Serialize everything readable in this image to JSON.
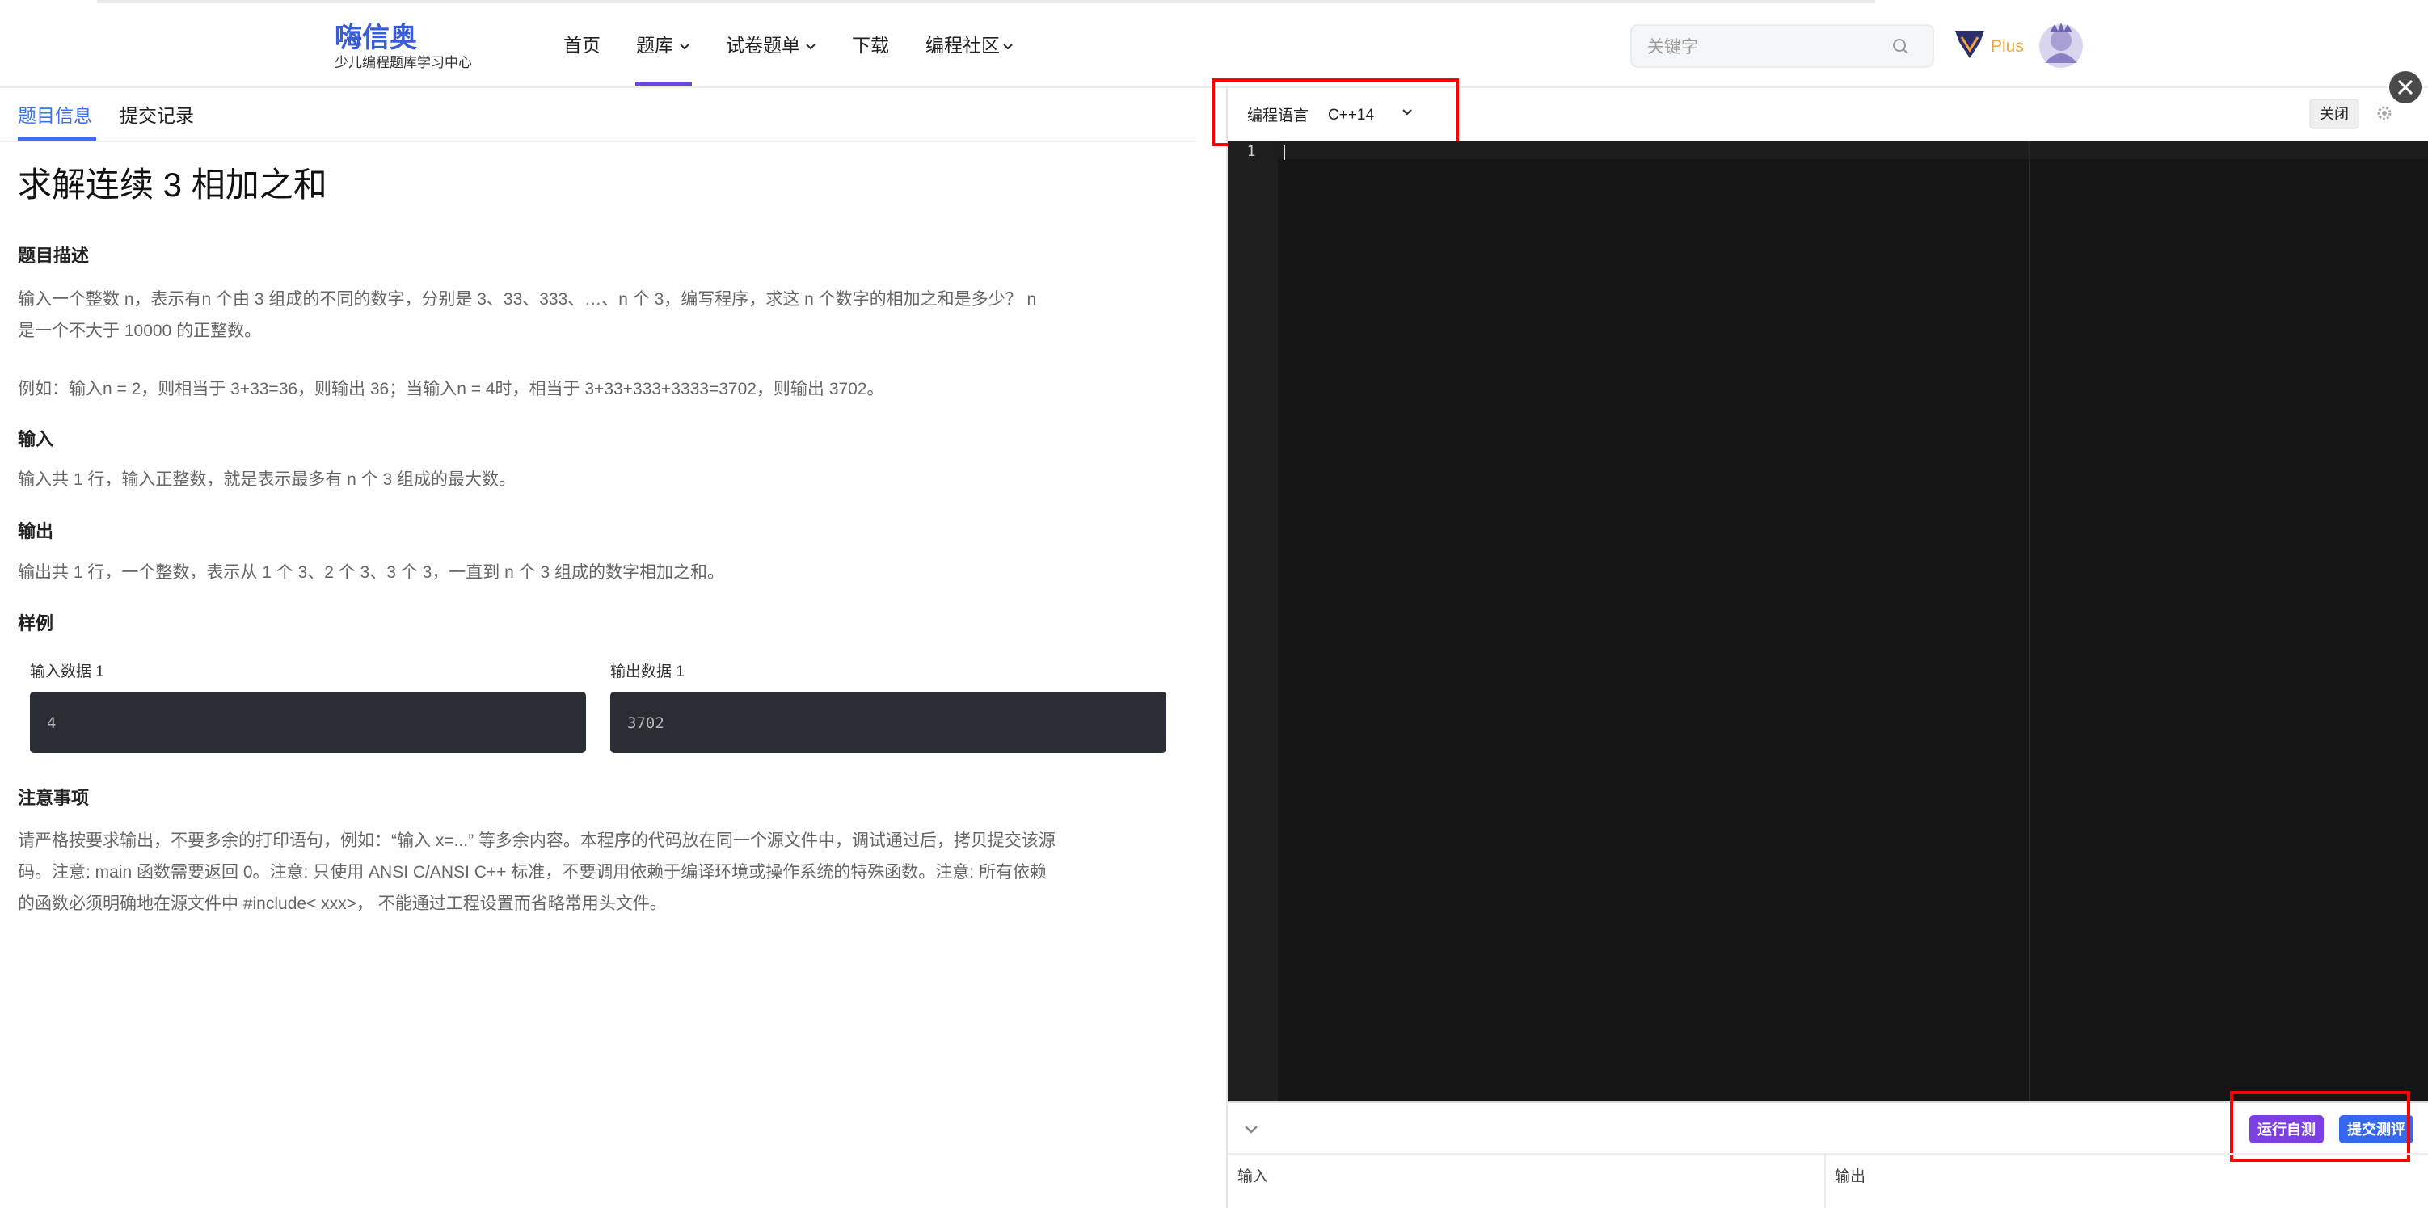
{
  "brand": {
    "logo_text": "嗨信奥",
    "subtitle": "少儿编程题库学习中心"
  },
  "nav": {
    "items": [
      {
        "label": "首页",
        "has_dropdown": false,
        "active": false
      },
      {
        "label": "题库",
        "has_dropdown": true,
        "active": true
      },
      {
        "label": "试卷题单",
        "has_dropdown": true,
        "active": false
      },
      {
        "label": "下载",
        "has_dropdown": false,
        "active": false
      },
      {
        "label": "编程社区",
        "has_dropdown": true,
        "active": false
      }
    ]
  },
  "search": {
    "placeholder": "关键字",
    "icon": "search-icon"
  },
  "user": {
    "plus_label": "Plus",
    "badge_icon": "vip-badge-icon",
    "avatar": "avatar"
  },
  "left_tabs": [
    {
      "label": "题目信息",
      "active": true
    },
    {
      "label": "提交记录",
      "active": false
    }
  ],
  "problem": {
    "title": "求解连续 3 相加之和",
    "description_heading": "题目描述",
    "description_line1": "输入一个整数 n，表示有n 个由 3 组成的不同的数字，分别是 3、33、333、…、n 个 3，编写程序，求这 n 个数字的相加之和是多少？ n",
    "description_line2": "是一个不大于 10000 的正整数。",
    "example_line": "例如：输入n = 2，则相当于 3+33=36，则输出 36；当输入n = 4时，相当于 3+33+333+3333=3702，则输出 3702。",
    "input_heading": "输入",
    "input_text": "输入共 1 行，输入正整数，就是表示最多有 n 个 3 组成的最大数。",
    "output_heading": "输出",
    "output_text": "输出共 1 行，一个整数，表示从 1 个 3、2 个 3、3 个 3，一直到 n 个 3 组成的数字相加之和。",
    "sample_heading": "样例",
    "sample_input_label": "输入数据 1",
    "sample_input_value": "4",
    "sample_output_label": "输出数据 1",
    "sample_output_value": "3702",
    "notes_heading": "注意事项",
    "notes_line1": "请严格按要求输出，不要多余的打印语句，例如：“输入 x=...” 等多余内容。本程序的代码放在同一个源文件中，调试通过后，拷贝提交该源",
    "notes_line2": "码。注意: main 函数需要返回 0。注意: 只使用 ANSI C/ANSI C++ 标准，不要调用依赖于编译环境或操作系统的特殊函数。注意: 所有依赖",
    "notes_line3": "的函数必须明确地在源文件中 #include< xxx>， 不能通过工程设置而省略常用头文件。"
  },
  "editor": {
    "lang_label": "编程语言",
    "lang_value": "C++14",
    "close_label": "关闭",
    "settings_icon": "gear-icon",
    "line_number": "1",
    "collapse_icon": "chevron-down-icon",
    "run_label": "运行自测",
    "submit_label": "提交测评",
    "io_input_label": "输入",
    "io_output_label": "输出",
    "close_overlay_icon": "close-icon"
  },
  "colors": {
    "accent": "#3b6ff5",
    "annotation_red": "#ff0000",
    "editor_bg": "#151515",
    "gutter_bg": "#1e1e1e",
    "sample_bg": "#2a2d34",
    "run_btn": "#7b3fe4",
    "submit_btn": "#3568f0",
    "plus_gold": "#f2a640"
  }
}
